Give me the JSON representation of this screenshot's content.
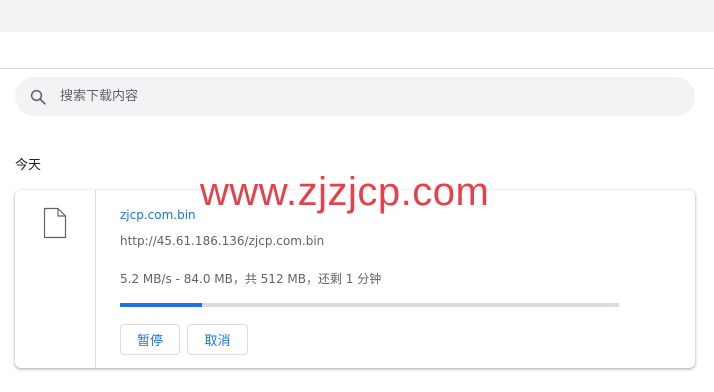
{
  "search": {
    "placeholder": "搜索下载内容"
  },
  "section": {
    "title": "今天"
  },
  "watermark": {
    "text": "www.zjzjcp.com"
  },
  "download": {
    "file_name": "zjcp.com.bin",
    "url": "http://45.61.186.136/zjcp.com.bin",
    "status": "5.2 MB/s - 84.0 MB，共 512 MB，还剩 1 分钟",
    "progress_fraction": 0.164,
    "pause_label": "暂停",
    "cancel_label": "取消"
  },
  "colors": {
    "accent": "#1a73e8",
    "watermark": "#e8404a",
    "search_bg": "#f1f3f4"
  },
  "icons": {
    "search": "search-icon",
    "file": "file-icon"
  }
}
